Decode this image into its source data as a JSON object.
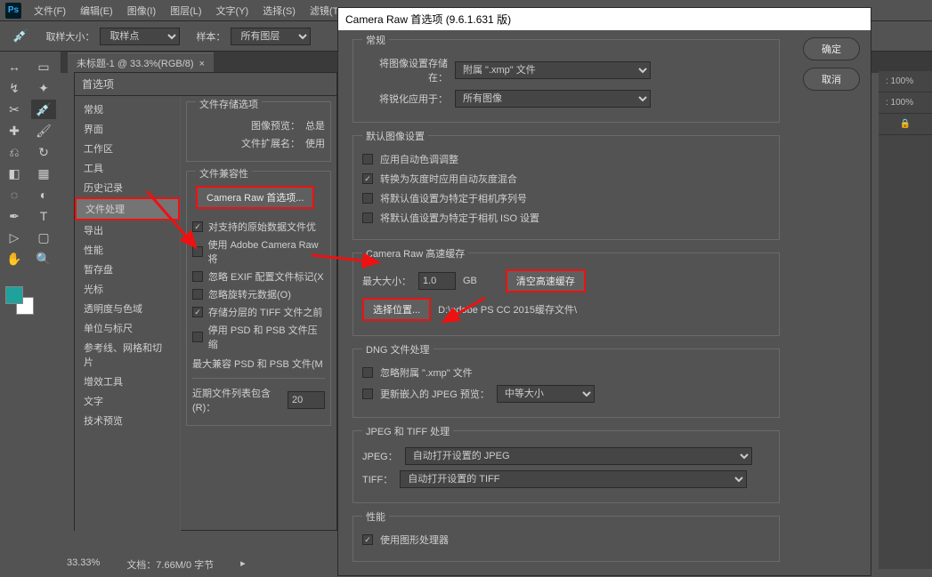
{
  "menubar": {
    "logo": "Ps",
    "items": [
      "文件(F)",
      "编辑(E)",
      "图像(I)",
      "图层(L)",
      "文字(Y)",
      "选择(S)",
      "滤镜(T)"
    ]
  },
  "options_bar": {
    "sample_size_label": "取样大小：",
    "sample_size_value": "取样点",
    "sample_label": "样本：",
    "sample_value": "所有图层"
  },
  "tab": {
    "title": "未标题-1 @ 33.3%(RGB/8)"
  },
  "prefs": {
    "title": "首选项",
    "side": [
      "常规",
      "界面",
      "工作区",
      "工具",
      "历史记录",
      "文件处理",
      "导出",
      "性能",
      "暂存盘",
      "光标",
      "透明度与色域",
      "单位与标尺",
      "参考线、网格和切片",
      "增效工具",
      "文字",
      "技术预览"
    ],
    "active_index": 5,
    "g1_title": "文件存储选项",
    "g1_preview_label": "图像预览：",
    "g1_preview_value": "总是",
    "g1_ext_label": "文件扩展名：",
    "g1_ext_value": "使用",
    "g2_title": "文件兼容性",
    "craw_btn": "Camera Raw 首选项...",
    "c1": "对支持的原始数据文件优",
    "c2": "使用 Adobe Camera Raw 将",
    "c3": "忽略 EXIF 配置文件标记(X",
    "c4": "忽略旋转元数据(O)",
    "c5": "存储分层的 TIFF 文件之前",
    "c6": "停用 PSD 和 PSB 文件压缩",
    "psb_label": "最大兼容 PSD 和 PSB 文件(M",
    "recent_label": "近期文件列表包含(R)：",
    "recent_value": "20"
  },
  "craw": {
    "title": "Camera Raw 首选项  (9.6.1.631 版)",
    "ok": "确定",
    "cancel": "取消",
    "g_general": "常规",
    "save_in_label": "将图像设置存储在：",
    "save_in_value": "附属 \".xmp\" 文件",
    "sharpen_label": "将锐化应用于：",
    "sharpen_value": "所有图像",
    "g_default": "默认图像设置",
    "d1": "应用自动色调调整",
    "d2": "转换为灰度时应用自动灰度混合",
    "d3": "将默认值设置为特定于相机序列号",
    "d4": "将默认值设置为特定于相机 ISO 设置",
    "g_cache": "Camera Raw 高速缓存",
    "max_label": "最大大小：",
    "max_value": "1.0",
    "max_unit": "GB",
    "purge_btn": "清空高速缓存",
    "choose_btn": "选择位置...",
    "cache_path": "D:\\adobe PS CC 2015缓存文件\\",
    "g_dng": "DNG 文件处理",
    "dng1": "忽略附属 \".xmp\" 文件",
    "dng2": "更新嵌入的 JPEG 预览：",
    "dng2_value": "中等大小",
    "g_jt": "JPEG 和 TIFF 处理",
    "jpeg_label": "JPEG：",
    "jpeg_value": "自动打开设置的 JPEG",
    "tiff_label": "TIFF：",
    "tiff_value": "自动打开设置的 TIFF",
    "g_perf": "性能",
    "perf1": "使用图形处理器"
  },
  "right": {
    "pct1": ": 100%",
    "pct2": ": 100%",
    "lock": "🔒"
  },
  "status": {
    "zoom": "33.33%",
    "doc": "文档：7.66M/0 字节"
  }
}
